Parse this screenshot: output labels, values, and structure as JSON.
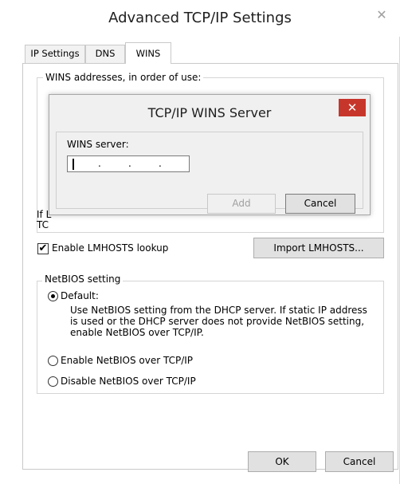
{
  "window": {
    "title": "Advanced TCP/IP Settings",
    "close_glyph": "✕"
  },
  "tabs": [
    {
      "label": "IP Settings"
    },
    {
      "label": "DNS"
    },
    {
      "label": "WINS",
      "active": true
    }
  ],
  "wins_group": {
    "label": "WINS addresses, in order of use:",
    "partial_text_1": "If L",
    "partial_text_2": "TC"
  },
  "lmhosts": {
    "checkbox_label": "Enable LMHOSTS lookup",
    "checked": true,
    "check_glyph": "✔",
    "import_button": "Import LMHOSTS..."
  },
  "netbios": {
    "label": "NetBIOS setting",
    "options": [
      {
        "label": "Default:",
        "selected": true
      },
      {
        "label": "Enable NetBIOS over TCP/IP",
        "selected": false
      },
      {
        "label": "Disable NetBIOS over TCP/IP",
        "selected": false
      }
    ],
    "default_description": "Use NetBIOS setting from the DHCP server. If static IP address is used or the DHCP server does not provide NetBIOS setting, enable NetBIOS over TCP/IP."
  },
  "footer": {
    "ok": "OK",
    "cancel": "Cancel"
  },
  "modal": {
    "title": "TCP/IP WINS Server",
    "close_glyph": "✕",
    "field_label": "WINS server:",
    "ip_separator": ".",
    "add_button": "Add",
    "cancel_button": "Cancel"
  },
  "colors": {
    "close_red": "#c7362b",
    "button_gray": "#e1e1e1",
    "disabled_text": "#a0a0a0"
  }
}
